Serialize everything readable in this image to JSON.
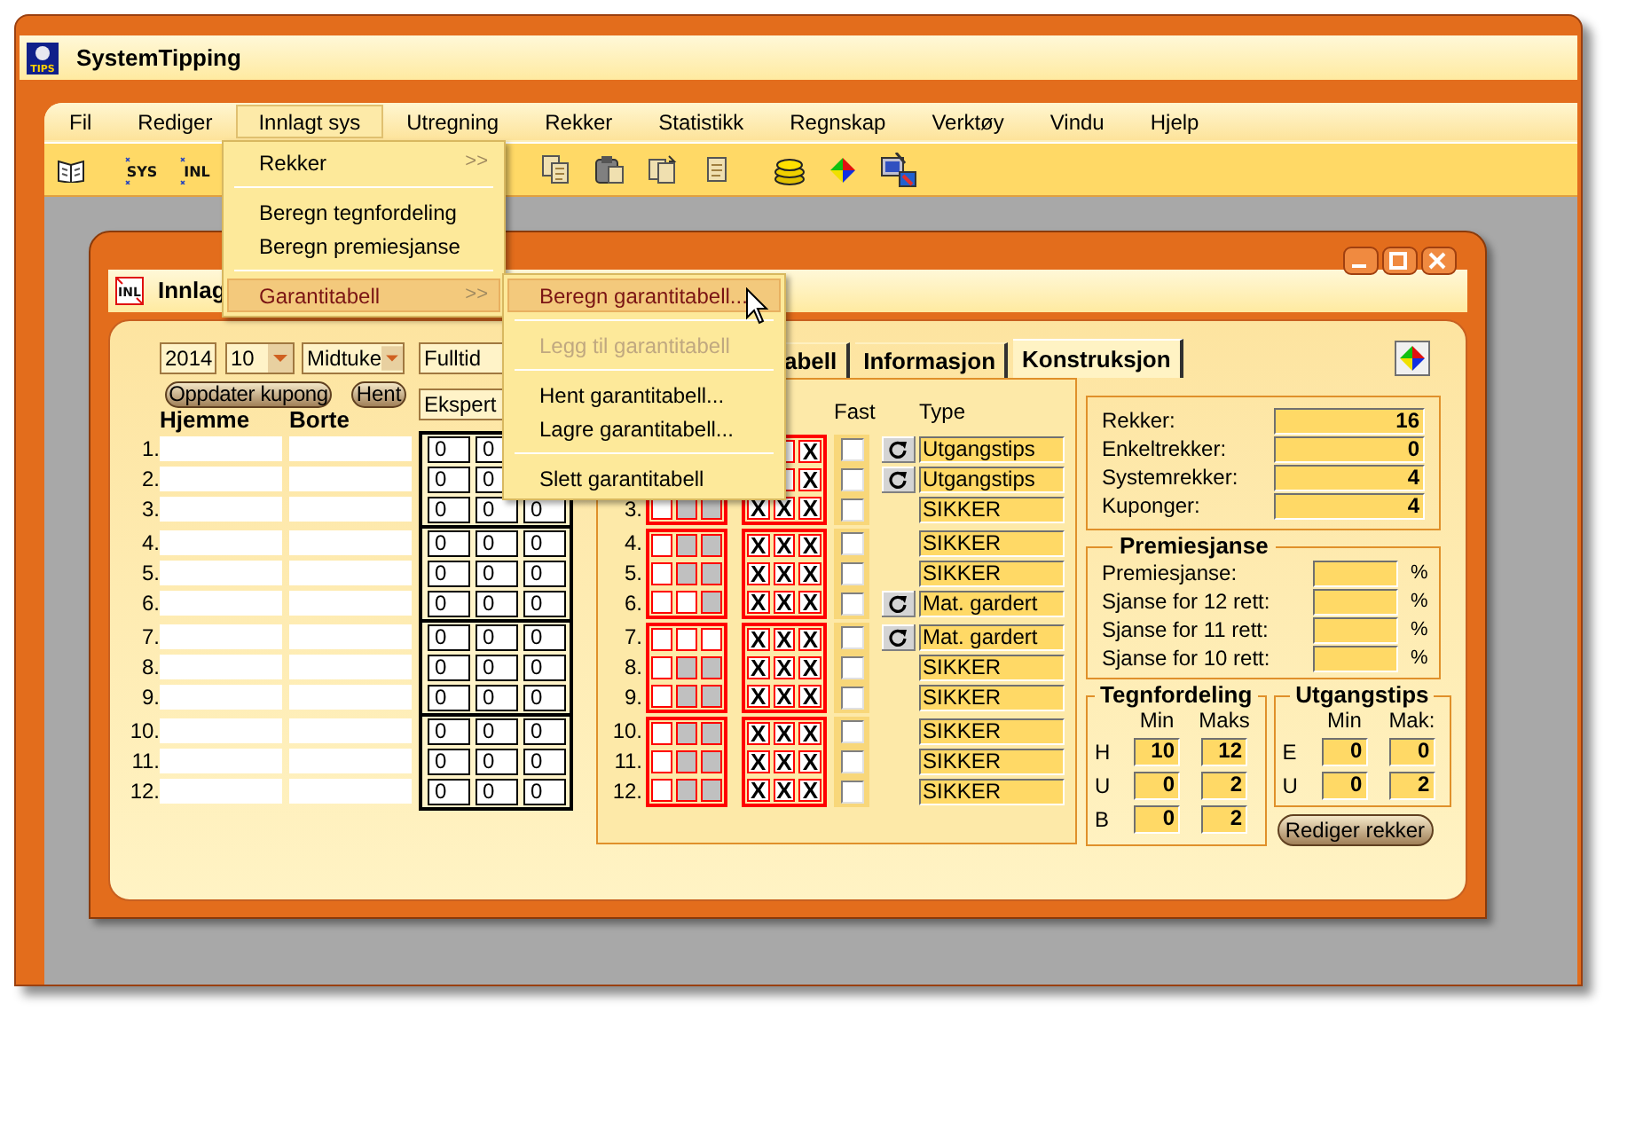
{
  "app": {
    "title": "SystemTipping",
    "icon_label": "TIPS"
  },
  "menu_bar": [
    {
      "label": "Fil",
      "selected": false
    },
    {
      "label": "Rediger",
      "selected": false
    },
    {
      "label": "Innlagt sys",
      "selected": true
    },
    {
      "label": "Utregning",
      "selected": false
    },
    {
      "label": "Rekker",
      "selected": false
    },
    {
      "label": "Statistikk",
      "selected": false
    },
    {
      "label": "Regnskap",
      "selected": false
    },
    {
      "label": "Verktøy",
      "selected": false
    },
    {
      "label": "Vindu",
      "selected": false
    },
    {
      "label": "Hjelp",
      "selected": false
    }
  ],
  "toolbar": [
    {
      "label": "SYS"
    },
    {
      "label": "INL"
    }
  ],
  "window": {
    "title": "Innlag",
    "icon_label": "INL"
  },
  "tabs": [
    {
      "label": "abell",
      "selected": false
    },
    {
      "label": "Informasjon",
      "selected": false
    },
    {
      "label": "Konstruksjon",
      "selected": true
    }
  ],
  "coupon": {
    "year": "2014",
    "week": "10",
    "draw": "Midtuke",
    "mode": "Fulltid",
    "level": "Ekspert",
    "update_button": "Oppdater kupong",
    "fetch_button": "Hent",
    "headers": [
      "Hjemme",
      "Borte"
    ]
  },
  "matches": [
    {
      "number": "1.",
      "odds": [
        "0",
        "0"
      ]
    },
    {
      "number": "2.",
      "odds": [
        "0",
        "0"
      ]
    },
    {
      "number": "3.",
      "odds": [
        "0",
        "0",
        "0"
      ]
    },
    {
      "number": "4.",
      "odds": [
        "0",
        "0",
        "0"
      ]
    },
    {
      "number": "5.",
      "odds": [
        "0",
        "0",
        "0"
      ]
    },
    {
      "number": "6.",
      "odds": [
        "0",
        "0",
        "0"
      ]
    },
    {
      "number": "7.",
      "odds": [
        "0",
        "0",
        "0"
      ]
    },
    {
      "number": "8.",
      "odds": [
        "0",
        "0",
        "0"
      ]
    },
    {
      "number": "9.",
      "odds": [
        "0",
        "0",
        "0"
      ]
    },
    {
      "number": "10.",
      "odds": [
        "0",
        "0",
        "0"
      ]
    },
    {
      "number": "11.",
      "odds": [
        "0",
        "0",
        "0"
      ]
    },
    {
      "number": "12.",
      "odds": [
        "0",
        "0",
        "0"
      ]
    }
  ],
  "system": {
    "fast_header": "Fast",
    "type_header": "Type",
    "rows": [
      {
        "signs": [
          "X"
        ],
        "fast": false,
        "button": true,
        "type": "Utgangstips"
      },
      {
        "signs": [
          "X"
        ],
        "fast": false,
        "button": true,
        "type": "Utgangstips"
      },
      {
        "number": "3.",
        "shaded": [
          false,
          true,
          true
        ],
        "signs": [
          "X",
          "X",
          "X"
        ],
        "fast": false,
        "button": false,
        "type": "SIKKER"
      },
      {
        "number": "4.",
        "shaded": [
          false,
          true,
          true
        ],
        "signs": [
          "X",
          "X",
          "X"
        ],
        "fast": false,
        "button": false,
        "type": "SIKKER"
      },
      {
        "number": "5.",
        "shaded": [
          false,
          true,
          true
        ],
        "signs": [
          "X",
          "X",
          "X"
        ],
        "fast": false,
        "button": false,
        "type": "SIKKER"
      },
      {
        "number": "6.",
        "shaded": [
          false,
          false,
          true
        ],
        "signs": [
          "X",
          "X",
          "X"
        ],
        "fast": false,
        "button": true,
        "type": "Mat. gardert"
      },
      {
        "number": "7.",
        "shaded": [
          false,
          false,
          false
        ],
        "signs": [
          "X",
          "X",
          "X"
        ],
        "fast": false,
        "button": true,
        "type": "Mat. gardert"
      },
      {
        "number": "8.",
        "shaded": [
          false,
          true,
          true
        ],
        "signs": [
          "X",
          "X",
          "X"
        ],
        "fast": false,
        "button": false,
        "type": "SIKKER"
      },
      {
        "number": "9.",
        "shaded": [
          false,
          true,
          true
        ],
        "signs": [
          "X",
          "X",
          "X"
        ],
        "fast": false,
        "button": false,
        "type": "SIKKER"
      },
      {
        "number": "10.",
        "shaded": [
          false,
          true,
          true
        ],
        "signs": [
          "X",
          "X",
          "X"
        ],
        "fast": false,
        "button": false,
        "type": "SIKKER"
      },
      {
        "number": "11.",
        "shaded": [
          false,
          true,
          true
        ],
        "signs": [
          "X",
          "X",
          "X"
        ],
        "fast": false,
        "button": false,
        "type": "SIKKER"
      },
      {
        "number": "12.",
        "shaded": [
          false,
          true,
          true
        ],
        "signs": [
          "X",
          "X",
          "X"
        ],
        "fast": false,
        "button": false,
        "type": "SIKKER"
      }
    ]
  },
  "stats": [
    {
      "label": "Rekker:",
      "value": "16"
    },
    {
      "label": "Enkeltrekker:",
      "value": "0"
    },
    {
      "label": "Systemrekker:",
      "value": "4"
    },
    {
      "label": "Kuponger:",
      "value": "4"
    }
  ],
  "premiesjanse": {
    "title": "Premiesjanse",
    "rows": [
      {
        "label": "Premiesjanse:",
        "unit": "%"
      },
      {
        "label": "Sjanse for 12 rett:",
        "unit": "%"
      },
      {
        "label": "Sjanse for 11 rett:",
        "unit": "%"
      },
      {
        "label": "Sjanse for 10 rett:",
        "unit": "%"
      }
    ]
  },
  "tegnfordeling": {
    "title": "Tegnfordeling",
    "columns": [
      "Min",
      "Maks"
    ],
    "rows": [
      {
        "sign": "H",
        "min": "10",
        "max": "12"
      },
      {
        "sign": "U",
        "min": "0",
        "max": "2"
      },
      {
        "sign": "B",
        "min": "0",
        "max": "2"
      }
    ]
  },
  "utgangstips": {
    "title": "Utgangstips",
    "columns": [
      "Min",
      "Mak:"
    ],
    "rows": [
      {
        "sign": "E",
        "min": "0",
        "max": "0"
      },
      {
        "sign": "U",
        "min": "0",
        "max": "2"
      }
    ]
  },
  "edit_button": "Rediger rekker",
  "open_menu": {
    "items": [
      {
        "kind": "item",
        "label": "Rekker",
        "arrow": ">>",
        "selected": false
      },
      {
        "kind": "separator"
      },
      {
        "kind": "item",
        "label": "Beregn tegnfordeling",
        "selected": false
      },
      {
        "kind": "item",
        "label": "Beregn premiesjanse",
        "selected": false
      },
      {
        "kind": "separator"
      },
      {
        "kind": "item",
        "label": "Garantitabell",
        "arrow": ">>",
        "selected": true
      }
    ]
  },
  "submenu": {
    "items": [
      {
        "kind": "item",
        "label": "Beregn garantitabell...",
        "selected": true,
        "disabled": false
      },
      {
        "kind": "separator"
      },
      {
        "kind": "item",
        "label": "Legg til garantitabell",
        "selected": false,
        "disabled": true
      },
      {
        "kind": "separator"
      },
      {
        "kind": "item",
        "label": "Hent garantitabell...",
        "selected": false,
        "disabled": false
      },
      {
        "kind": "item",
        "label": "Lagre garantitabell...",
        "selected": false,
        "disabled": false
      },
      {
        "kind": "separator"
      },
      {
        "kind": "item",
        "label": "Slett garantitabell",
        "selected": false,
        "disabled": false
      }
    ]
  }
}
